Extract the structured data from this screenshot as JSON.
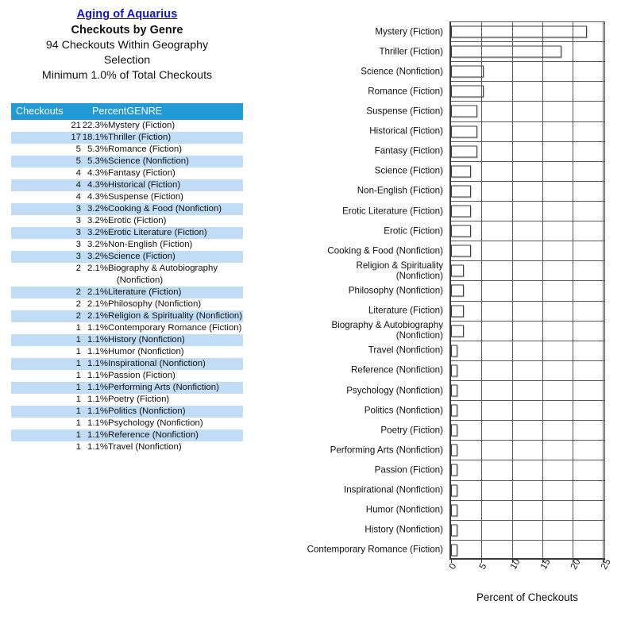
{
  "header": {
    "link_title": "Aging of Aquarius",
    "subtitle": "Checkouts by Genre",
    "line3": "94 Checkouts Within Geography",
    "line4": "Selection",
    "line5": "Minimum 1.0% of Total Checkouts",
    "link_color": "#1414cc"
  },
  "table": {
    "columns": [
      "Checkouts",
      "PercentGENRE"
    ],
    "header_bg": "#229ad6",
    "alt_row_bg": "#c0ddf5",
    "rows": [
      {
        "checkouts": "21",
        "percent": "22.3%",
        "genre": "Mystery (Fiction)"
      },
      {
        "checkouts": "17",
        "percent": "18.1%",
        "genre": "Thriller (Fiction)"
      },
      {
        "checkouts": "5",
        "percent": "5.3%",
        "genre": "Romance (Fiction)"
      },
      {
        "checkouts": "5",
        "percent": "5.3%",
        "genre": "Science (Nonfiction)"
      },
      {
        "checkouts": "4",
        "percent": "4.3%",
        "genre": "Fantasy (Fiction)"
      },
      {
        "checkouts": "4",
        "percent": "4.3%",
        "genre": "Historical (Fiction)"
      },
      {
        "checkouts": "4",
        "percent": "4.3%",
        "genre": "Suspense (Fiction)"
      },
      {
        "checkouts": "3",
        "percent": "3.2%",
        "genre": "Cooking & Food (Nonfiction)"
      },
      {
        "checkouts": "3",
        "percent": "3.2%",
        "genre": "Erotic (Fiction)"
      },
      {
        "checkouts": "3",
        "percent": "3.2%",
        "genre": "Erotic Literature (Fiction)"
      },
      {
        "checkouts": "3",
        "percent": "3.2%",
        "genre": "Non-English (Fiction)"
      },
      {
        "checkouts": "3",
        "percent": "3.2%",
        "genre": "Science (Fiction)"
      },
      {
        "checkouts": "2",
        "percent": "2.1%",
        "genre": "Biography & Autobiography",
        "genre_line2": "(Nonfiction)"
      },
      {
        "checkouts": "2",
        "percent": "2.1%",
        "genre": "Literature (Fiction)"
      },
      {
        "checkouts": "2",
        "percent": "2.1%",
        "genre": "Philosophy (Nonfiction)"
      },
      {
        "checkouts": "2",
        "percent": "2.1%",
        "genre": "Religion & Spirituality (Nonfiction)"
      },
      {
        "checkouts": "1",
        "percent": "1.1%",
        "genre": "Contemporary Romance (Fiction)"
      },
      {
        "checkouts": "1",
        "percent": "1.1%",
        "genre": "History (Nonfiction)"
      },
      {
        "checkouts": "1",
        "percent": "1.1%",
        "genre": "Humor (Nonfiction)"
      },
      {
        "checkouts": "1",
        "percent": "1.1%",
        "genre": "Inspirational (Nonfiction)"
      },
      {
        "checkouts": "1",
        "percent": "1.1%",
        "genre": "Passion (Fiction)"
      },
      {
        "checkouts": "1",
        "percent": "1.1%",
        "genre": "Performing Arts (Nonfiction)"
      },
      {
        "checkouts": "1",
        "percent": "1.1%",
        "genre": "Poetry (Fiction)"
      },
      {
        "checkouts": "1",
        "percent": "1.1%",
        "genre": "Politics (Nonfiction)"
      },
      {
        "checkouts": "1",
        "percent": "1.1%",
        "genre": "Psychology (Nonfiction)"
      },
      {
        "checkouts": "1",
        "percent": "1.1%",
        "genre": "Reference (Nonfiction)"
      },
      {
        "checkouts": "1",
        "percent": "1.1%",
        "genre": "Travel (Nonfiction)"
      }
    ]
  },
  "chart_data": {
    "type": "bar",
    "orientation": "horizontal",
    "title": "",
    "xlabel": "Percent of Checkouts",
    "ylabel": "",
    "xlim": [
      0,
      25.6
    ],
    "xticks": [
      0,
      5,
      10,
      15,
      20,
      25
    ],
    "xtick_labels": [
      "0",
      "5",
      "10",
      "15",
      "20",
      "25"
    ],
    "grid": "vertical",
    "bar_color_dark": "#5d0014",
    "bar_color_highlight": "#f52a58",
    "categories": [
      "Mystery (Fiction)",
      "Thriller (Fiction)",
      "Science (Nonfiction)",
      "Romance (Fiction)",
      "Suspense (Fiction)",
      "Historical (Fiction)",
      "Fantasy (Fiction)",
      "Science (Fiction)",
      "Non-English (Fiction)",
      "Erotic Literature (Fiction)",
      "Erotic (Fiction)",
      "Cooking & Food (Nonfiction)",
      "Religion & Spirituality (Nonfiction)",
      "Philosophy (Nonfiction)",
      "Literature (Fiction)",
      "Biography & Autobiography (Nonfiction)",
      "Travel (Nonfiction)",
      "Reference (Nonfiction)",
      "Psychology (Nonfiction)",
      "Politics (Nonfiction)",
      "Poetry (Fiction)",
      "Performing Arts (Nonfiction)",
      "Passion (Fiction)",
      "Inspirational (Nonfiction)",
      "Humor (Nonfiction)",
      "History (Nonfiction)",
      "Contemporary Romance (Fiction)"
    ],
    "values": [
      22.3,
      18.1,
      5.3,
      5.3,
      4.3,
      4.3,
      4.3,
      3.2,
      3.2,
      3.2,
      3.2,
      3.2,
      2.1,
      2.1,
      2.1,
      2.1,
      1.1,
      1.1,
      1.1,
      1.1,
      1.1,
      1.1,
      1.1,
      1.1,
      1.1,
      1.1,
      1.1
    ]
  }
}
